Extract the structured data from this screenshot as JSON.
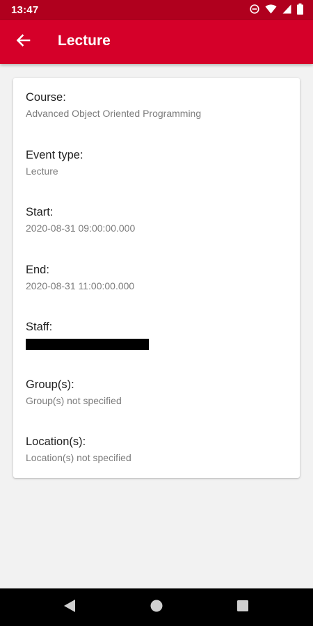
{
  "status_bar": {
    "time": "13:47",
    "icons": [
      "do-not-disturb-icon",
      "wifi-icon",
      "cell-signal-icon",
      "battery-icon"
    ]
  },
  "app_bar": {
    "title": "Lecture",
    "back_icon": "arrow-left-icon",
    "background": "#d50029"
  },
  "details": {
    "course": {
      "label": "Course:",
      "value": "Advanced Object Oriented Programming"
    },
    "event_type": {
      "label": "Event type:",
      "value": "Lecture"
    },
    "start": {
      "label": "Start:",
      "value": "2020-08-31 09:00:00.000"
    },
    "end": {
      "label": "End:",
      "value": "2020-08-31 11:00:00.000"
    },
    "staff": {
      "label": "Staff:"
    },
    "groups": {
      "label": "Group(s):",
      "value": "Group(s) not specified"
    },
    "locations": {
      "label": "Location(s):",
      "value": "Location(s) not specified"
    }
  },
  "nav_bar": {
    "buttons": [
      "back-triangle-icon",
      "home-circle-icon",
      "recents-square-icon"
    ]
  }
}
